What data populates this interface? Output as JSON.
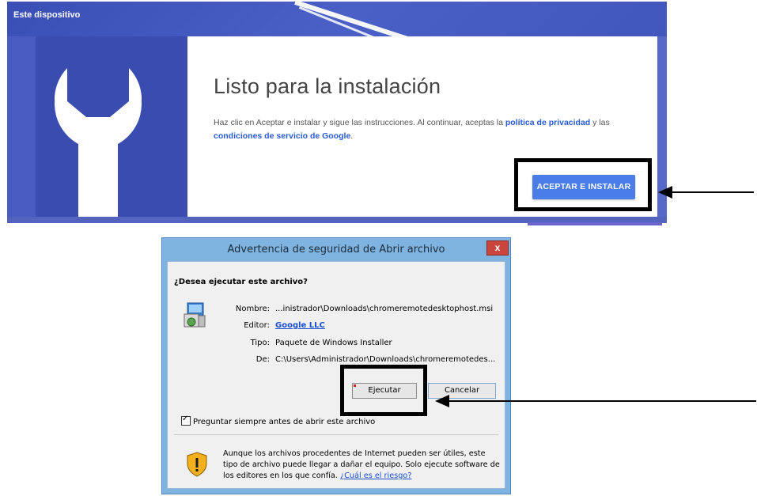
{
  "installer_page": {
    "header": {
      "device_label": "Este dispositivo"
    },
    "title": "Listo para la instalación",
    "description_prefix": "Haz clic en Aceptar e instalar y sigue las instrucciones. Al continuar, aceptas la ",
    "privacy_link": "política de privacidad",
    "description_middle": " y las ",
    "terms_link": "condiciones de servicio de Google",
    "description_suffix": ".",
    "accept_button": "ACEPTAR E INSTALAR",
    "colors": {
      "banner": "#3d52b9",
      "button": "#4a7de8",
      "link": "#2a5bd7"
    }
  },
  "security_dialog": {
    "title": "Advertencia de seguridad de Abrir archivo",
    "close_label": "x",
    "question": "¿Desea ejecutar este archivo?",
    "fields": {
      "name": {
        "label": "Nombre:",
        "value": "...inistrador\\Downloads\\chromeremotedesktophost.msi"
      },
      "editor": {
        "label": "Editor:",
        "value": "Google LLC"
      },
      "type": {
        "label": "Tipo:",
        "value": "Paquete de Windows Installer"
      },
      "from": {
        "label": "De:",
        "value": "C:\\Users\\Administrador\\Downloads\\chromeremotedes..."
      }
    },
    "run_button": "Ejecutar",
    "cancel_button": "Cancelar",
    "always_ask": {
      "label": "Preguntar siempre antes de abrir este archivo",
      "checked": true
    },
    "warning_text": "Aunque los archivos procedentes de Internet pueden ser útiles, este tipo de archivo puede llegar a dañar el equipo. Solo ejecute software de los editores en los que confía. ",
    "risk_link": "¿Cuál es el riesgo?"
  }
}
